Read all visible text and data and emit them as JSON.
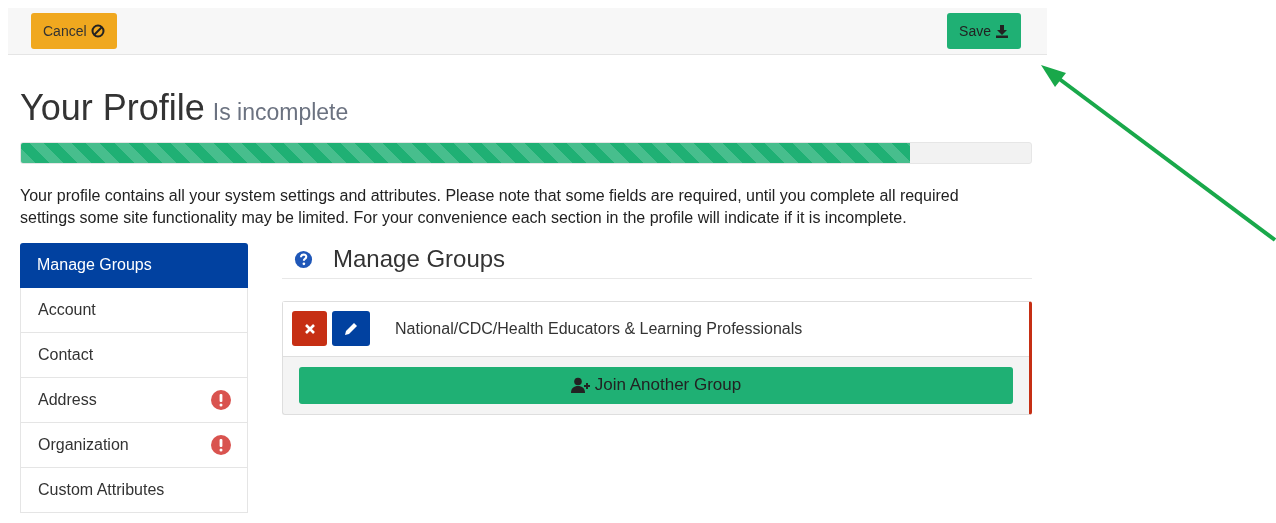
{
  "toolbar": {
    "cancel": "Cancel",
    "save": "Save"
  },
  "profile": {
    "title": "Your Profile",
    "status": "Is incomplete",
    "progress": {
      "level": 0.88
    }
  },
  "intro": "Your profile contains all your system settings and attributes. Please note that some fields are required, until you complete all required settings some site functionality may be limited. For your convenience each section in the profile will indicate if it is incomplete.",
  "sidebar": {
    "items": [
      {
        "label": "Manage Groups",
        "selected": true,
        "incomplete": false
      },
      {
        "label": "Account",
        "selected": false,
        "incomplete": false
      },
      {
        "label": "Contact",
        "selected": false,
        "incomplete": false
      },
      {
        "label": "Address",
        "selected": false,
        "incomplete": true
      },
      {
        "label": "Organization",
        "selected": false,
        "incomplete": true
      },
      {
        "label": "Custom Attributes",
        "selected": false,
        "incomplete": false
      }
    ]
  },
  "section": {
    "title": "Manage Groups",
    "groups": [
      {
        "name": "National/CDC/Health Educators & Learning Professionals"
      }
    ],
    "join_button": "Join Another Group"
  }
}
